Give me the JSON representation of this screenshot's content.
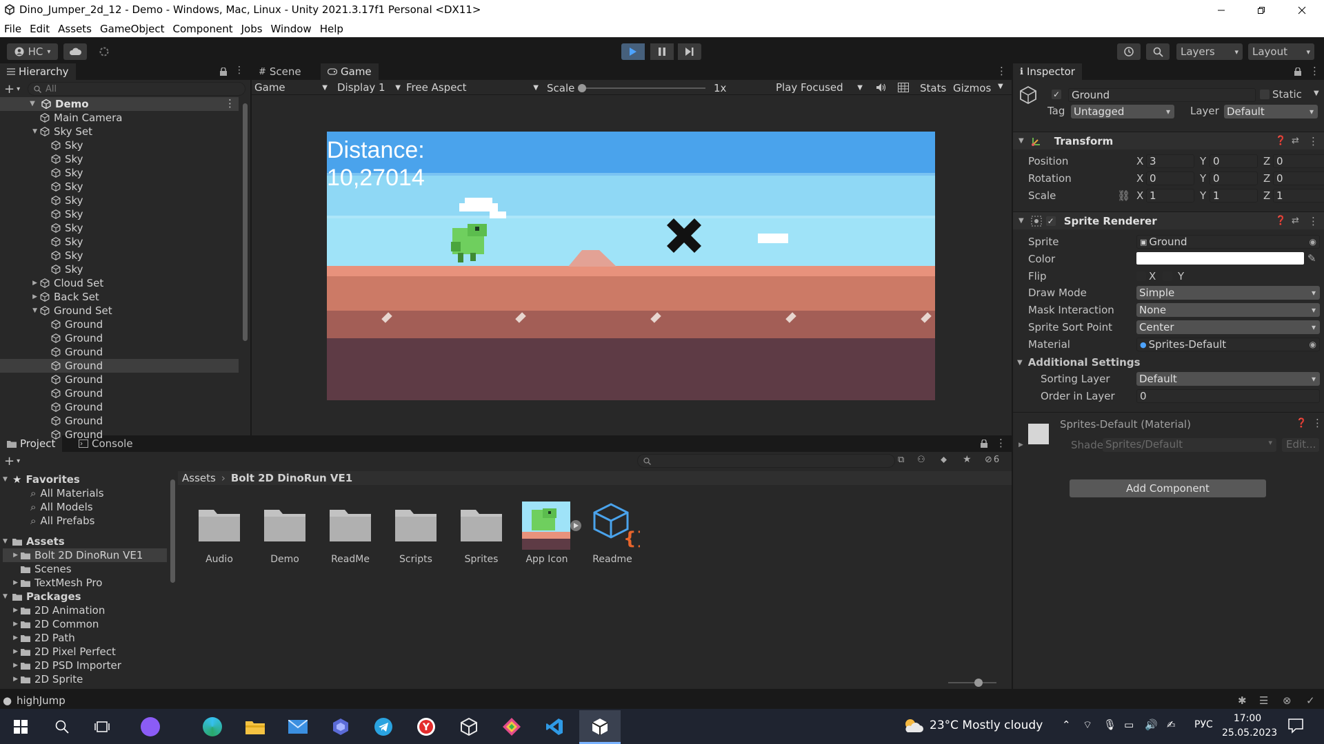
{
  "window": {
    "title": "Dino_Jumper_2d_12 - Demo - Windows, Mac, Linux - Unity 2021.3.17f1 Personal <DX11>"
  },
  "menu": [
    "File",
    "Edit",
    "Assets",
    "GameObject",
    "Component",
    "Jobs",
    "Window",
    "Help"
  ],
  "toolbar": {
    "account": "HC",
    "layers": "Layers",
    "layout": "Layout"
  },
  "hierarchy": {
    "tab": "Hierarchy",
    "search_placeholder": "All",
    "scene": "Demo",
    "items": [
      {
        "label": "Main Camera",
        "depth": 1
      },
      {
        "label": "Sky Set",
        "depth": 1,
        "expanded": true
      },
      {
        "label": "Sky",
        "depth": 2
      },
      {
        "label": "Sky",
        "depth": 2
      },
      {
        "label": "Sky",
        "depth": 2
      },
      {
        "label": "Sky",
        "depth": 2
      },
      {
        "label": "Sky",
        "depth": 2
      },
      {
        "label": "Sky",
        "depth": 2
      },
      {
        "label": "Sky",
        "depth": 2
      },
      {
        "label": "Sky",
        "depth": 2
      },
      {
        "label": "Sky",
        "depth": 2
      },
      {
        "label": "Sky",
        "depth": 2
      },
      {
        "label": "Cloud Set",
        "depth": 1,
        "expanded": false
      },
      {
        "label": "Back Set",
        "depth": 1,
        "expanded": false
      },
      {
        "label": "Ground Set",
        "depth": 1,
        "expanded": true
      },
      {
        "label": "Ground",
        "depth": 2
      },
      {
        "label": "Ground",
        "depth": 2
      },
      {
        "label": "Ground",
        "depth": 2
      },
      {
        "label": "Ground",
        "depth": 2,
        "selected": true
      },
      {
        "label": "Ground",
        "depth": 2
      },
      {
        "label": "Ground",
        "depth": 2
      },
      {
        "label": "Ground",
        "depth": 2
      },
      {
        "label": "Ground",
        "depth": 2
      },
      {
        "label": "Ground",
        "depth": 2
      }
    ]
  },
  "gameview": {
    "tabs": [
      "Scene",
      "Game"
    ],
    "game_dropdown": "Game",
    "display": "Display 1",
    "aspect": "Free Aspect",
    "scale_label": "Scale",
    "scale_value": "1x",
    "play_focused": "Play Focused",
    "stats": "Stats",
    "gizmos": "Gizmos",
    "distance_label": "Distance:",
    "distance_value": "10,27014"
  },
  "inspector": {
    "tab": "Inspector",
    "object_name": "Ground",
    "static_label": "Static",
    "tag_label": "Tag",
    "tag": "Untagged",
    "layer_label": "Layer",
    "layer": "Default",
    "transform": {
      "title": "Transform",
      "position_label": "Position",
      "rotation_label": "Rotation",
      "scale_label": "Scale",
      "position": {
        "x": "3",
        "y": "0",
        "z": "0"
      },
      "rotation": {
        "x": "0",
        "y": "0",
        "z": "0"
      },
      "scale": {
        "x": "1",
        "y": "1",
        "z": "1"
      }
    },
    "sprite_renderer": {
      "title": "Sprite Renderer",
      "sprite_label": "Sprite",
      "sprite": "Ground",
      "color_label": "Color",
      "color": "#ffffff",
      "flip_label": "Flip",
      "flip_x": "X",
      "flip_y": "Y",
      "draw_mode_label": "Draw Mode",
      "draw_mode": "Simple",
      "mask_label": "Mask Interaction",
      "mask": "None",
      "sort_point_label": "Sprite Sort Point",
      "sort_point": "Center",
      "material_label": "Material",
      "material": "Sprites-Default",
      "additional_label": "Additional Settings",
      "sorting_layer_label": "Sorting Layer",
      "sorting_layer": "Default",
      "order_label": "Order in Layer",
      "order": "0"
    },
    "material": {
      "title": "Sprites-Default (Material)",
      "shader_label": "Shader",
      "shader": "Sprites/Default",
      "edit": "Edit..."
    },
    "add_component": "Add Component"
  },
  "project": {
    "tabs": [
      "Project",
      "Console"
    ],
    "breadcrumb": [
      "Assets",
      "Bolt 2D DinoRun VE1"
    ],
    "hidden_count": "6",
    "favorites_label": "Favorites",
    "favorites": [
      "All Materials",
      "All Models",
      "All Prefabs"
    ],
    "assets_label": "Assets",
    "assets_tree": [
      "Bolt 2D DinoRun VE1",
      "Scenes",
      "TextMesh Pro"
    ],
    "packages_label": "Packages",
    "packages": [
      "2D Animation",
      "2D Common",
      "2D Path",
      "2D Pixel Perfect",
      "2D PSD Importer",
      "2D Sprite"
    ],
    "assets": [
      {
        "label": "Audio",
        "type": "folder"
      },
      {
        "label": "Demo",
        "type": "folder"
      },
      {
        "label": "ReadMe",
        "type": "folder"
      },
      {
        "label": "Scripts",
        "type": "folder"
      },
      {
        "label": "Sprites",
        "type": "folder"
      },
      {
        "label": "App Icon",
        "type": "image"
      },
      {
        "label": "Readme",
        "type": "asset"
      }
    ]
  },
  "statusbar": {
    "message": "highJump"
  },
  "taskbar": {
    "weather": "23°C  Mostly cloudy",
    "lang": "РУС",
    "time": "17:00",
    "date": "25.05.2023"
  },
  "colors": {
    "accent": "#2c5d87",
    "sky": "#4aa3ec",
    "ground_top": "#e8927c",
    "ground_bottom": "#5e3b45"
  }
}
